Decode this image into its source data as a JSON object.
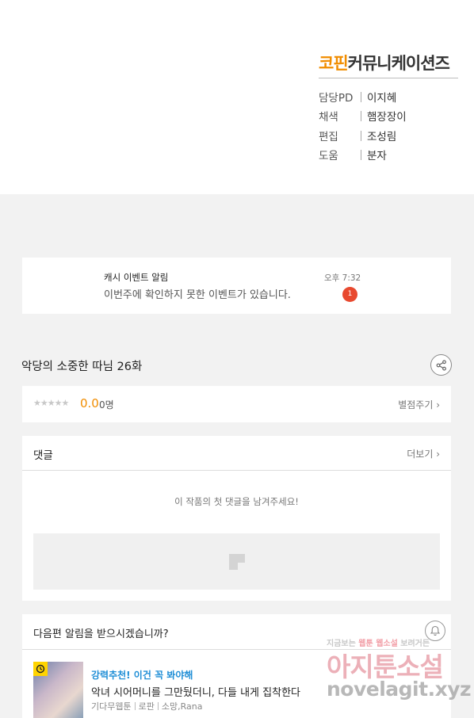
{
  "credits": {
    "logo_orange": "코핀",
    "logo_dark": "커뮤니케이션즈",
    "rows": [
      {
        "role": "담당PD",
        "name": "이지혜"
      },
      {
        "role": "채색",
        "name": "햄장장이"
      },
      {
        "role": "편집",
        "name": "조성림"
      },
      {
        "role": "도움",
        "name": "분자"
      }
    ]
  },
  "notification": {
    "title": "캐시 이벤트 알림",
    "body": "이번주에 확인하지 못한 이벤트가 있습니다.",
    "time": "오후 7:32",
    "badge_count": "1"
  },
  "episode": {
    "title": "악당의 소중한 따님 26화",
    "share_icon": "share-icon"
  },
  "rating": {
    "stars": "★★★★★",
    "score": "0.0",
    "count": "0명",
    "rate_link": "별점주기 ›"
  },
  "comments": {
    "title": "댓글",
    "more_link": "더보기 ›",
    "empty_message": "이 작품의 첫 댓글을 남겨주세요!"
  },
  "next_alert": {
    "question": "다음편 알림을 받으시겠습니까?",
    "recommend_label": "강력추천! 이건 꼭 봐야해",
    "recommend_title": "악녀 시어머니를 그만뒀더니, 다들 내게 집착한다",
    "meta": [
      "기다무웹툰",
      "로판",
      "소망,Rana"
    ]
  },
  "watermark": {
    "tagline_gray": "지금보는",
    "tagline_pink_1": "웹툰",
    "tagline_pink_2": "웹소설",
    "tagline_tail": "보려거든",
    "brand": "아지툰소설",
    "url": "novelagit.xyz"
  }
}
